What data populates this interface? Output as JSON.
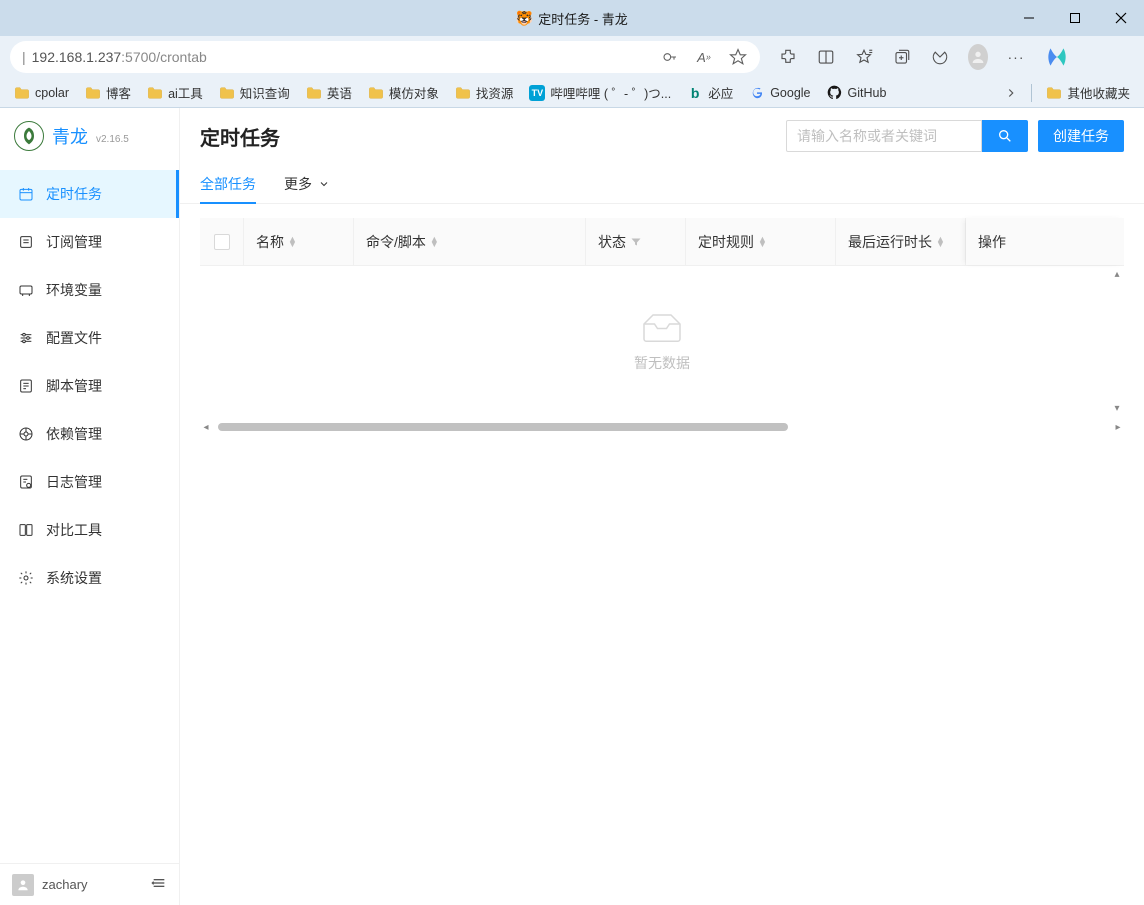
{
  "window": {
    "title": "定时任务 - 青龙",
    "icon": "🐯"
  },
  "address": {
    "host": "192.168.1.237",
    "port_path": ":5700/crontab"
  },
  "bookmarks": [
    {
      "icon": "folder",
      "label": "cpolar"
    },
    {
      "icon": "folder",
      "label": "博客"
    },
    {
      "icon": "folder",
      "label": "ai工具"
    },
    {
      "icon": "folder",
      "label": "知识查询"
    },
    {
      "icon": "folder",
      "label": "英语"
    },
    {
      "icon": "folder",
      "label": "模仿对象"
    },
    {
      "icon": "folder",
      "label": "找资源"
    },
    {
      "icon": "bili",
      "label": "哔哩哔哩 ( ゜- ゜)つ..."
    },
    {
      "icon": "bing",
      "label": "必应"
    },
    {
      "icon": "google",
      "label": "Google"
    },
    {
      "icon": "github",
      "label": "GitHub"
    }
  ],
  "bookmarks_other": "其他收藏夹",
  "app": {
    "name": "青龙",
    "version": "v2.16.5"
  },
  "sidebar": {
    "items": [
      {
        "icon": "clock",
        "label": "定时任务",
        "active": true
      },
      {
        "icon": "subscribe",
        "label": "订阅管理"
      },
      {
        "icon": "env",
        "label": "环境变量"
      },
      {
        "icon": "config",
        "label": "配置文件"
      },
      {
        "icon": "script",
        "label": "脚本管理"
      },
      {
        "icon": "deps",
        "label": "依赖管理"
      },
      {
        "icon": "logs",
        "label": "日志管理"
      },
      {
        "icon": "diff",
        "label": "对比工具"
      },
      {
        "icon": "settings",
        "label": "系统设置"
      }
    ],
    "user": "zachary"
  },
  "content": {
    "title": "定时任务",
    "search_placeholder": "请输入名称或者关键词",
    "create_label": "创建任务",
    "tabs": {
      "all": "全部任务",
      "more": "更多"
    },
    "columns": {
      "name": "名称",
      "command": "命令/脚本",
      "status": "状态",
      "cron": "定时规则",
      "duration": "最后运行时长",
      "action": "操作"
    },
    "empty": "暂无数据"
  }
}
